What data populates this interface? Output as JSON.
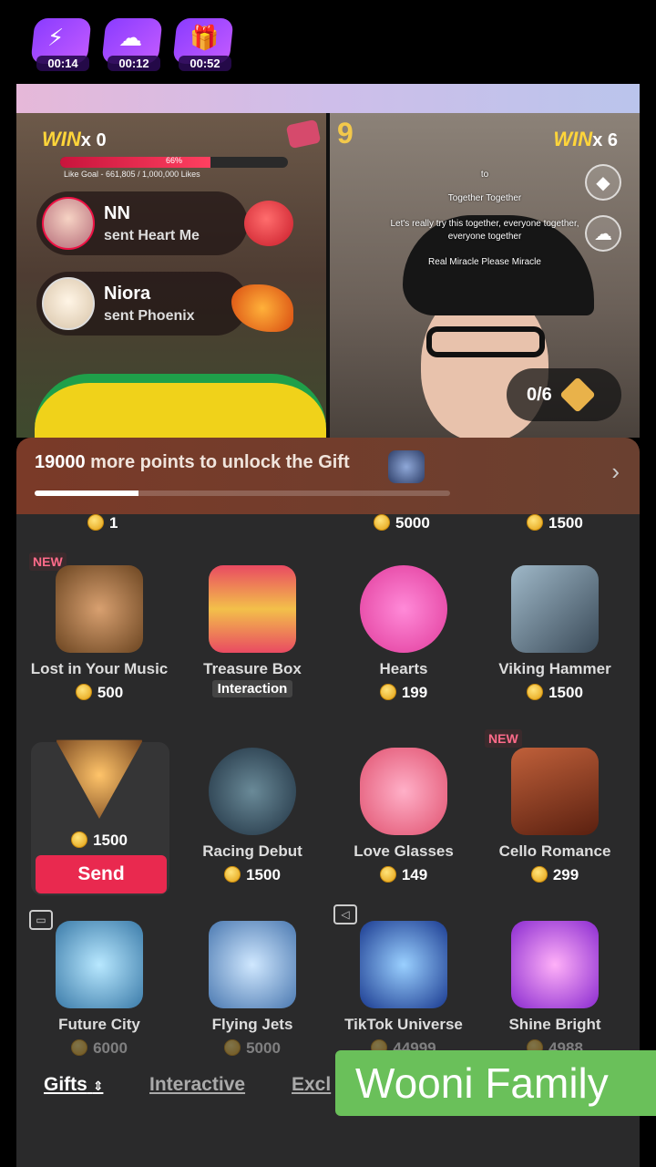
{
  "timers": [
    {
      "icon": "lightning-icon",
      "glyph": "⚡",
      "time": "00:14"
    },
    {
      "icon": "cloud-icon",
      "glyph": "☁",
      "time": "00:12"
    },
    {
      "icon": "gift-box-icon",
      "glyph": "🎁",
      "time": "00:52"
    }
  ],
  "battle": {
    "left_win_label": "WIN",
    "left_win_count": "x 0",
    "right_win_label": "WIN",
    "right_win_count": "x 6",
    "round": "9",
    "goal_pct": "66%",
    "goal_fraction": 0.66,
    "goal_text": "Like Goal - 661,805 / 1,000,000 Likes",
    "progress": "0/6"
  },
  "notifications": [
    {
      "name": "NN",
      "message": "sent Heart Me"
    },
    {
      "name": "Niora",
      "message": "sent Phoenix"
    }
  ],
  "captions": [
    "to",
    "Together Together",
    "Let's really try this together, everyone together,",
    "everyone together",
    "Real Miracle Please Miracle"
  ],
  "unlock": {
    "points": "19000",
    "text": " more points to unlock the Gift",
    "progress_fraction": 0.25
  },
  "top_prices": [
    "1",
    "5000",
    "1500"
  ],
  "gifts": [
    {
      "name": "Lost in Your Music",
      "price": "500",
      "new": "NEW"
    },
    {
      "name": "Treasure Box",
      "price": "",
      "tag": "Interaction"
    },
    {
      "name": "Hearts",
      "price": "199"
    },
    {
      "name": "Viking Hammer",
      "price": "1500"
    },
    {
      "name": "",
      "price": "1500"
    },
    {
      "name": "Racing Debut",
      "price": "1500"
    },
    {
      "name": "Love Glasses",
      "price": "149"
    },
    {
      "name": "Cello Romance",
      "price": "299",
      "new": "NEW"
    },
    {
      "name": "Future City",
      "price": "6000"
    },
    {
      "name": "Flying Jets",
      "price": "5000"
    },
    {
      "name": "TikTok Universe",
      "price": "44999"
    },
    {
      "name": "Shine Bright",
      "price": "4988"
    }
  ],
  "send_label": "Send",
  "tabs": [
    "Gifts",
    "Interactive",
    "Excl"
  ],
  "watermark": "Wooni Family",
  "colors": {
    "accent": "#e9294f",
    "coin": "#e3a012",
    "panel": "#2a2a2b"
  }
}
